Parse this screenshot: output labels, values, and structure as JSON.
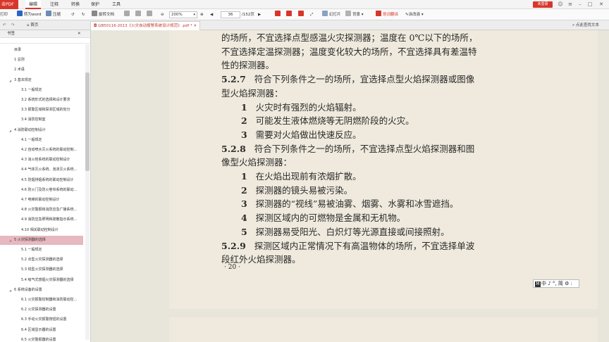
{
  "app": {
    "name": "击PDF",
    "menu": [
      "编辑",
      "注释",
      "转换",
      "保护",
      "工具"
    ],
    "active_menu": "编辑",
    "login": "未登录"
  },
  "toolbar": {
    "print": "打印",
    "to_word": "转为word",
    "compress": "压缩",
    "rotate": "旋转文档",
    "zoom": "200%",
    "page_current": "36",
    "page_total": "/152页",
    "slideshow": "幻灯片",
    "background": "背景",
    "translate": "划词翻译",
    "annotate": "涂改液"
  },
  "tabs": {
    "home": "首页",
    "doc": "GB50116-2013《火灾自动报警系统设计规范》.pdf *",
    "find": "点此查找文本"
  },
  "sidebar": {
    "title": "书签",
    "items": [
      {
        "label": "目录",
        "level": 0
      },
      {
        "label": "1 总则",
        "level": 0
      },
      {
        "label": "2 术语",
        "level": 0
      },
      {
        "label": "3 基本规定",
        "level": 0,
        "expanded": true
      },
      {
        "label": "3.1 一般规定",
        "level": 1
      },
      {
        "label": "3.2 系统形式的选择和设计要求",
        "level": 1
      },
      {
        "label": "3.3 报警区域和探测区域的划分",
        "level": 1
      },
      {
        "label": "3.4 消防控制室",
        "level": 1
      },
      {
        "label": "4 消防联动控制设计",
        "level": 0,
        "expanded": true
      },
      {
        "label": "4.1 一般规定",
        "level": 1
      },
      {
        "label": "4.2 自动喷水灭火系统的联动控制...",
        "level": 1
      },
      {
        "label": "4.3 消火栓系统的联动控制设计",
        "level": 1
      },
      {
        "label": "4.4 气体灭火系统、泡沫灭火系统...",
        "level": 1
      },
      {
        "label": "4.5 防烟排烟系统的联动控制设计",
        "level": 1
      },
      {
        "label": "4.6 防火门及防火卷帘系统的联动...",
        "level": 1
      },
      {
        "label": "4.7 电梯的联动控制设计",
        "level": 1
      },
      {
        "label": "4.8 火灾警报和消防应急广播系统...",
        "level": 1
      },
      {
        "label": "4.9 消防应急照明和疏散指示系统...",
        "level": 1
      },
      {
        "label": "4.10 相关联动控制设计",
        "level": 1
      },
      {
        "label": "5 火灾探测器的选择",
        "level": 0,
        "expanded": true,
        "selected": true
      },
      {
        "label": "5.1 一般规定",
        "level": 1
      },
      {
        "label": "5.2 点型火灾探测器的选择",
        "level": 1
      },
      {
        "label": "5.3 线型火灾探测器的选择",
        "level": 1
      },
      {
        "label": "5.4 吸气式感烟火灾探测器的选择",
        "level": 1
      },
      {
        "label": "6 系统设备的设置",
        "level": 0,
        "expanded": true
      },
      {
        "label": "6.1 火灾报警控制器和消防联动控...",
        "level": 1
      },
      {
        "label": "6.2 火灾探测器的设置",
        "level": 1
      },
      {
        "label": "6.3 手动火灾报警按钮的设置",
        "level": 1
      },
      {
        "label": "6.4 区域显示器的设置",
        "level": 1
      },
      {
        "label": "6.5 火灾警报器的设置",
        "level": 1
      }
    ]
  },
  "document": {
    "lines": [
      {
        "text": "的场所，不宜选择点型感温火灾探测器；温度在 0℃以下的场所，",
        "indent": 0
      },
      {
        "text": "不宜选择定温探测器；温度变化较大的场所，不宜选择具有差温特",
        "indent": 0
      },
      {
        "text": "性的探测器。",
        "indent": 0
      },
      {
        "clause": "5.2.7",
        "text": "符合下列条件之一的场所，宜选择点型火焰探测器或图像",
        "indent": 0
      },
      {
        "text": "型火焰探测器：",
        "indent": 0
      },
      {
        "num": "1",
        "text": "火灾时有强烈的火焰辐射。",
        "indent": 1
      },
      {
        "num": "2",
        "text": "可能发生液体燃烧等无阴燃阶段的火灾。",
        "indent": 1
      },
      {
        "num": "3",
        "text": "需要对火焰做出快速反应。",
        "indent": 1
      },
      {
        "clause": "5.2.8",
        "text": "符合下列条件之一的场所，不宜选择点型火焰探测器和图",
        "indent": 0
      },
      {
        "text": "像型火焰探测器：",
        "indent": 0
      },
      {
        "num": "1",
        "text": "在火焰出现前有浓烟扩散。",
        "indent": 1
      },
      {
        "num": "2",
        "text": "探测器的镜头易被污染。",
        "indent": 1
      },
      {
        "num": "3",
        "text": "探测器的“视线”易被油雾、烟雾、水雾和冰雪遮挡。",
        "indent": 1
      },
      {
        "num": "4",
        "text": "探测区域内的可燃物是金属和无机物。",
        "indent": 1
      },
      {
        "num": "5",
        "text": "探测器易受阳光、白炽灯等光源直接或间接照射。",
        "indent": 1
      },
      {
        "clause": "5.2.9",
        "text": "探测区域内正常情况下有高温物体的场所，不宜选择单波",
        "indent": 0
      },
      {
        "text": "段红外火焰探测器。",
        "indent": 0
      }
    ],
    "page_footer": "· 20 ·"
  },
  "ime": {
    "mode": "M",
    "text": "中 ♪ °, 简 ⚙ :"
  },
  "colors": {
    "accent": "#d9362b",
    "page_bg": "#efeadd",
    "selected_toc": "#e7b8bf"
  }
}
